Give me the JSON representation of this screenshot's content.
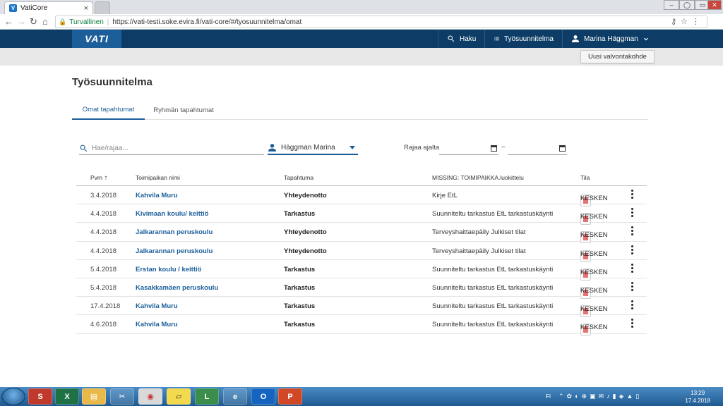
{
  "browser": {
    "tab_title": "VatiCore",
    "tab_close": "×",
    "favicon_letter": "V",
    "secure_label": "Turvallinen",
    "url": "https://vati-testi.soke.evira.fi/vati-core/#/tyosuunnitelma/omat"
  },
  "app": {
    "logo": "VATI",
    "nav": {
      "search_label": "Haku",
      "workplan_label": "Työsuunnitelma",
      "user_label": "Marina Häggman"
    },
    "new_target_button": "Uusi valvontakohde"
  },
  "page": {
    "title": "Työsuunnitelma",
    "tabs": [
      {
        "label": "Omat tapahtumat",
        "active": true
      },
      {
        "label": "Ryhmän tapahtumat",
        "active": false
      }
    ]
  },
  "filters": {
    "search_placeholder": "Hae/rajaa...",
    "user_value": "Häggman Marina",
    "date_label": "Rajaa ajalta",
    "date_from": "",
    "date_to": "",
    "date_separator": "–"
  },
  "table": {
    "headers": {
      "date": "Pvm",
      "sort_arrow": "↑",
      "place": "Toimipaikan nimi",
      "event": "Tapahtuma",
      "classification": "MISSING: TOIMIPAIKKA.luokittelu",
      "status": "Tila"
    },
    "rows": [
      {
        "date": "3.4.2018",
        "place": "Kahvila Muru",
        "event": "Yhteydenotto",
        "classification": "Kirje EtL",
        "status": "KESKEN"
      },
      {
        "date": "4.4.2018",
        "place": "Kivimaan koulu/ keittiö",
        "event": "Tarkastus",
        "classification": "Suunniteltu tarkastus EtL tarkastuskäynti",
        "status": "KESKEN"
      },
      {
        "date": "4.4.2018",
        "place": "Jalkarannan peruskoulu",
        "event": "Yhteydenotto",
        "classification": "Terveyshaittaepäily Julkiset tilat",
        "status": "KESKEN"
      },
      {
        "date": "4.4.2018",
        "place": "Jalkarannan peruskoulu",
        "event": "Yhteydenotto",
        "classification": "Terveyshaittaepäily Julkiset tilat",
        "status": "KESKEN"
      },
      {
        "date": "5.4.2018",
        "place": "Erstan koulu / keittiö",
        "event": "Tarkastus",
        "classification": "Suunniteltu tarkastus EtL tarkastuskäynti",
        "status": "KESKEN"
      },
      {
        "date": "5.4.2018",
        "place": "Kasakkamäen peruskoulu",
        "event": "Tarkastus",
        "classification": "Suunniteltu tarkastus EtL tarkastuskäynti",
        "status": "KESKEN"
      },
      {
        "date": "17.4.2018",
        "place": "Kahvila Muru",
        "event": "Tarkastus",
        "classification": "Suunniteltu tarkastus EtL tarkastuskäynti",
        "status": "KESKEN"
      },
      {
        "date": "4.6.2018",
        "place": "Kahvila Muru",
        "event": "Tarkastus",
        "classification": "Suunniteltu tarkastus EtL tarkastuskäynti",
        "status": "KESKEN"
      }
    ]
  },
  "taskbar": {
    "language": "FI",
    "time": "13:29",
    "date": "17.4.2018"
  },
  "colors": {
    "header_bg": "#0d3d66",
    "accent": "#1b5e9a",
    "status_doc_icon": "#e57373"
  }
}
